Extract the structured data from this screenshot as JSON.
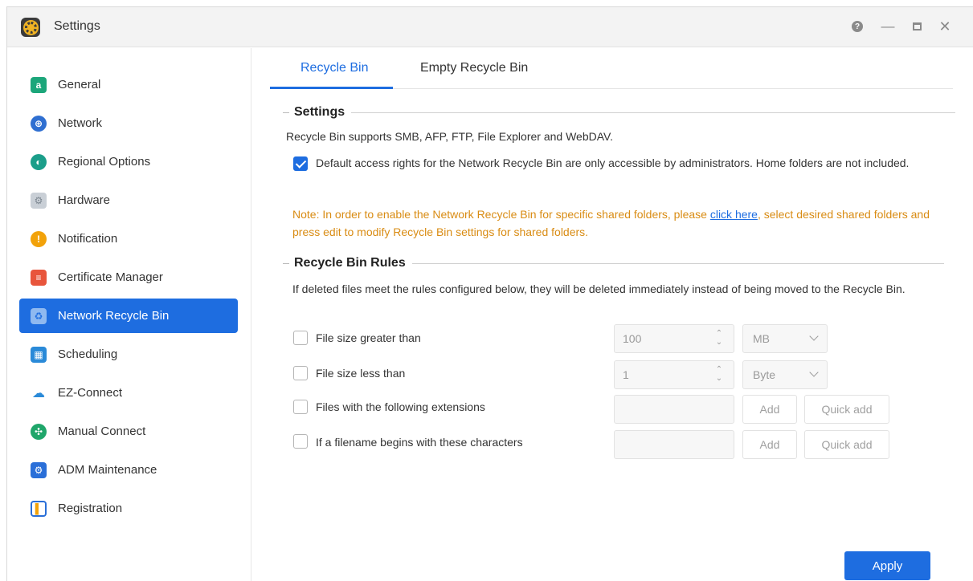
{
  "window": {
    "title": "Settings",
    "accent_color": "#1e6de0"
  },
  "sidebar": {
    "items": [
      {
        "label": "General",
        "icon": "general-icon",
        "color": "#1ca67a"
      },
      {
        "label": "Network",
        "icon": "globe-icon",
        "color": "#2f6fd1"
      },
      {
        "label": "Regional Options",
        "icon": "regional-globe-icon",
        "color": "#1b9e8a"
      },
      {
        "label": "Hardware",
        "icon": "hardware-icon",
        "color": "#b8c0c8"
      },
      {
        "label": "Notification",
        "icon": "alert-icon",
        "color": "#f2a20a"
      },
      {
        "label": "Certificate Manager",
        "icon": "certificate-icon",
        "color": "#e8553c"
      },
      {
        "label": "Network Recycle Bin",
        "icon": "recycle-bin-icon",
        "color": "#8fb9f0",
        "active": true
      },
      {
        "label": "Scheduling",
        "icon": "calendar-clock-icon",
        "color": "#2a8ad8"
      },
      {
        "label": "EZ-Connect",
        "icon": "cloud-upload-icon",
        "color": "#2a8ad8"
      },
      {
        "label": "Manual Connect",
        "icon": "manual-connect-icon",
        "color": "#1fa66a"
      },
      {
        "label": "ADM Maintenance",
        "icon": "maintenance-icon",
        "color": "#2a6fd8"
      },
      {
        "label": "Registration",
        "icon": "registration-icon",
        "color": "#2a6fd8"
      }
    ]
  },
  "tabs": [
    {
      "label": "Recycle Bin",
      "active": true
    },
    {
      "label": "Empty Recycle Bin",
      "active": false
    }
  ],
  "settings": {
    "title": "Settings",
    "description": "Recycle Bin supports SMB, AFP, FTP, File Explorer and WebDAV.",
    "default_access": {
      "checked": true,
      "label": "Default access rights for the Network Recycle Bin are only accessible by administrators. Home folders are not included."
    },
    "note_before": "Note: In order to enable the Network Recycle Bin for specific shared folders, please ",
    "note_link": "click here",
    "note_after": ", select desired shared folders and press edit to modify Recycle Bin settings for shared folders.",
    "note_color": "#d98c14"
  },
  "rules": {
    "title": "Recycle Bin Rules",
    "description": "If deleted files meet the rules configured below, they will be deleted immediately instead of being moved to the Recycle Bin.",
    "size_greater": {
      "label": "File size greater than",
      "value": "100",
      "unit": "MB",
      "checked": false
    },
    "size_less": {
      "label": "File size less than",
      "value": "1",
      "unit": "Byte",
      "checked": false
    },
    "extensions": {
      "label": "Files with the following extensions",
      "value": "",
      "add": "Add",
      "quick_add": "Quick add",
      "checked": false
    },
    "filename_begins": {
      "label": "If a filename begins with these characters",
      "value": "",
      "add": "Add",
      "quick_add": "Quick add",
      "checked": false
    }
  },
  "apply_label": "Apply"
}
